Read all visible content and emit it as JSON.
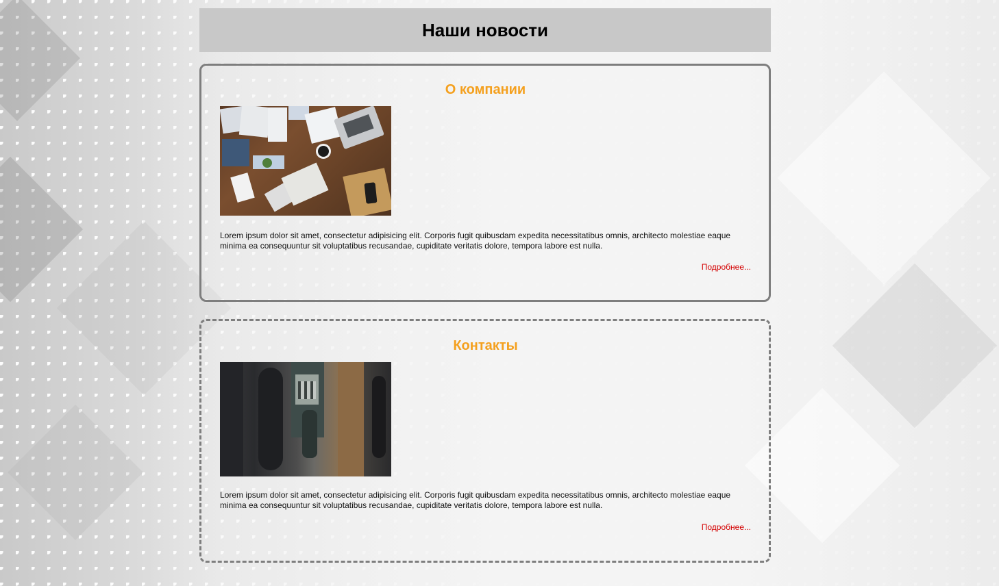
{
  "header": {
    "title": "Наши новости"
  },
  "news": [
    {
      "title": "О компании",
      "image_icon": "desk-with-laptop-and-papers-photo",
      "text": "Lorem ipsum dolor sit amet, consectetur adipisicing elit. Corporis fugit quibusdam expedita necessitatibus omnis, architecto molestiae eaque minima ea consequuntur sit voluptatibus recusandae, cupiditate veritatis dolore, tempora labore est nulla.",
      "more_label": "Подробнее..."
    },
    {
      "title": "Контакты",
      "image_icon": "payphone-photo",
      "text": "Lorem ipsum dolor sit amet, consectetur adipisicing elit. Corporis fugit quibusdam expedita necessitatibus omnis, architecto molestiae eaque minima ea consequuntur sit voluptatibus recusandae, cupiditate veritatis dolore, tempora labore est nulla.",
      "more_label": "Подробнее..."
    }
  ],
  "colors": {
    "card_title": "#f4a01e",
    "link": "#d40000",
    "header_bg": "#c8c8c8",
    "card_border": "#7e7e7e"
  }
}
